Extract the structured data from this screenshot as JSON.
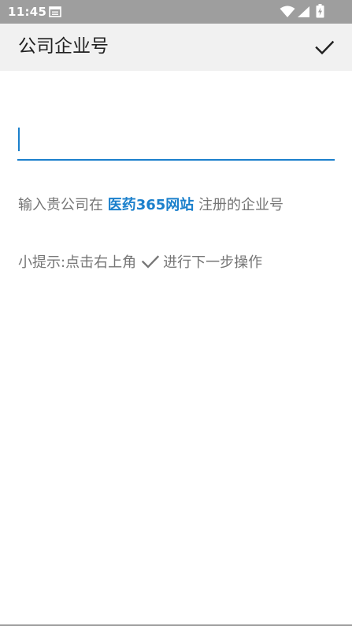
{
  "status_bar": {
    "time": "11:45"
  },
  "app_bar": {
    "title": "公司企业号"
  },
  "input": {
    "value": "",
    "placeholder": ""
  },
  "hint1": {
    "prefix": "输入贵公司在 ",
    "link": "医药365网站",
    "suffix": " 注册的企业号"
  },
  "hint2": {
    "prefix": "小提示:点击右上角",
    "suffix": "进行下一步操作"
  },
  "colors": {
    "accent": "#1b80cc",
    "status_bar": "#9e9e9e",
    "app_bar": "#f1f1f1",
    "hint_text": "#757575"
  }
}
